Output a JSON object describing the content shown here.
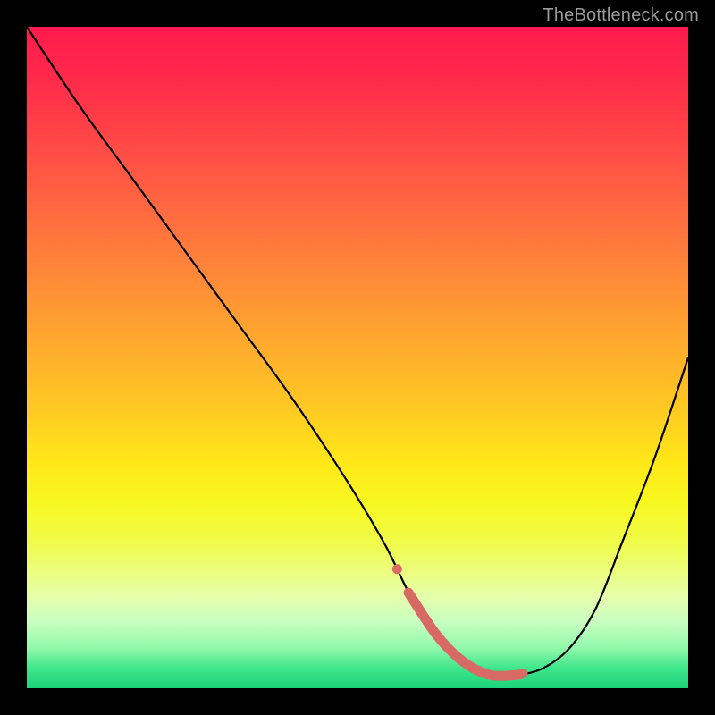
{
  "watermark": {
    "text": "TheBottleneck.com"
  },
  "chart_data": {
    "type": "line",
    "title": "",
    "xlabel": "",
    "ylabel": "",
    "xlim": [
      0,
      100
    ],
    "ylim": [
      0,
      100
    ],
    "series": [
      {
        "name": "curve",
        "x": [
          0,
          8,
          16,
          24,
          32,
          40,
          48,
          54,
          58,
          62,
          66,
          70,
          74,
          78,
          82,
          86,
          90,
          95,
          100
        ],
        "values": [
          100,
          88,
          77,
          66,
          55,
          44,
          32,
          22,
          14,
          8,
          4,
          2,
          2,
          3,
          6,
          12,
          22,
          35,
          50
        ]
      }
    ],
    "highlight_band_x": [
      58,
      75
    ],
    "gradient_stops": [
      {
        "pos": 0.0,
        "color": "#ff1a4d"
      },
      {
        "pos": 0.5,
        "color": "#ffca22"
      },
      {
        "pos": 0.8,
        "color": "#f0fb4a"
      },
      {
        "pos": 1.0,
        "color": "#1dd47a"
      }
    ]
  }
}
